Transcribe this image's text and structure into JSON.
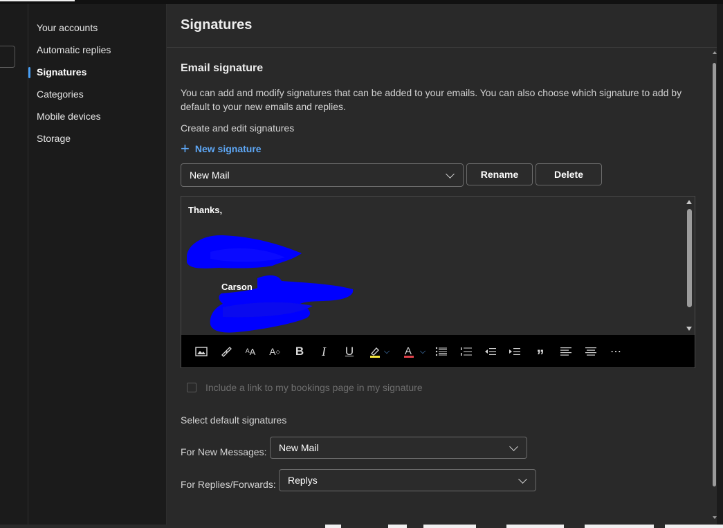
{
  "nav": {
    "items": [
      {
        "label": "Your accounts"
      },
      {
        "label": "Automatic replies"
      },
      {
        "label": "Signatures"
      },
      {
        "label": "Categories"
      },
      {
        "label": "Mobile devices"
      },
      {
        "label": "Storage"
      }
    ],
    "active": "Signatures"
  },
  "panel": {
    "title": "Signatures",
    "section_title": "Email signature",
    "description": "You can add and modify signatures that can be added to your emails. You can also choose which signature to add by default to your new emails and replies.",
    "create_label": "Create and edit signatures",
    "new_signature_label": "New signature",
    "signature_select": {
      "value": "New Mail"
    },
    "rename_label": "Rename",
    "delete_label": "Delete"
  },
  "editor": {
    "line1": "Thanks,",
    "name": "Carson",
    "redaction_color": "#0000ff",
    "toolbar_icons": [
      "image-icon",
      "format-painter-icon",
      "font-size-icon",
      "font-grow-icon",
      "bold-icon",
      "italic-icon",
      "underline-icon",
      "highlight-icon",
      "highlight-dropdown-icon",
      "font-color-icon",
      "font-color-dropdown-icon",
      "bullets-icon",
      "numbering-icon",
      "decrease-indent-icon",
      "increase-indent-icon",
      "quote-icon",
      "align-left-icon",
      "align-center-icon",
      "more-options-icon"
    ],
    "toolbar_glyphs": {
      "bold": "B",
      "italic": "I",
      "underline": "U",
      "quote": "”",
      "more": "⋯"
    }
  },
  "bookings_checkbox": {
    "label": "Include a link to my bookings page in my signature",
    "checked": false
  },
  "defaults": {
    "title": "Select default signatures",
    "new_messages_label": "For New Messages:",
    "new_messages_value": "New Mail",
    "replies_label": "For Replies/Forwards:",
    "replies_value": "Replys"
  },
  "colors": {
    "accent": "#479ef5",
    "link": "#5ea8f7",
    "background": "#292929"
  }
}
